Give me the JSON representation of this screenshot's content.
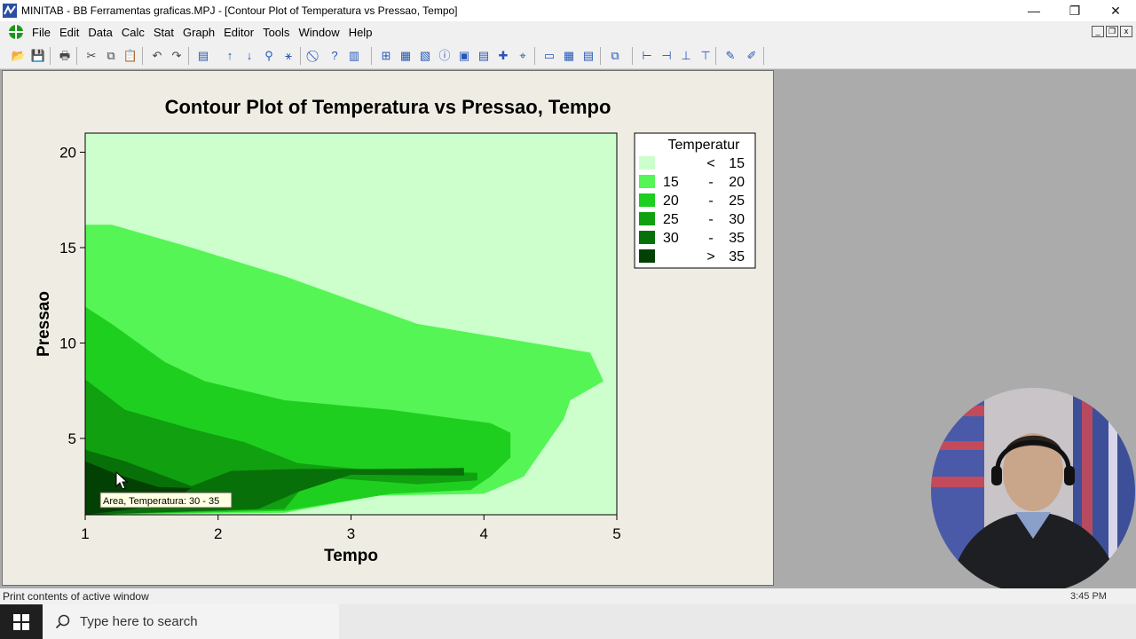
{
  "window": {
    "title": "MINITAB - BB Ferramentas graficas.MPJ - [Contour Plot of Temperatura vs Pressao, Tempo]",
    "minimize_glyph": "—",
    "restore_glyph": "❐",
    "close_glyph": "✕"
  },
  "menu": {
    "items": [
      "File",
      "Edit",
      "Data",
      "Calc",
      "Stat",
      "Graph",
      "Editor",
      "Tools",
      "Window",
      "Help"
    ],
    "mdi_minimize": "_",
    "mdi_restore": "❐",
    "mdi_close": "x"
  },
  "toolbar": {
    "icons": [
      "open-icon",
      "save-icon",
      "print-icon",
      "cut-icon",
      "copy-icon",
      "paste-icon",
      "undo-icon",
      "redo-icon",
      "session-window-icon",
      "up-arrow-icon",
      "down-arrow-icon",
      "binoculars-icon",
      "find-replace-icon",
      "cancel-icon",
      "help-icon",
      "manage-icon",
      "new-graph-icon",
      "worksheet-icon",
      "layout-icon",
      "info-icon",
      "history-icon",
      "report-pad-icon",
      "brush-icon",
      "select-icon",
      "edit-attributes-icon",
      "data-window-icon",
      "table-icon",
      "tile-icon",
      "add-icon",
      "remove-icon",
      "options-icon",
      "tools-icon",
      "pen-icon",
      "eraser-icon"
    ]
  },
  "chart_data": {
    "type": "contour",
    "title": "Contour Plot of Temperatura vs Pressao, Tempo",
    "xlabel": "Tempo",
    "ylabel": "Pressao",
    "xlim": [
      1,
      5
    ],
    "ylim": [
      1,
      21
    ],
    "xticks": [
      "1",
      "2",
      "3",
      "4",
      "5"
    ],
    "yticks": [
      "5",
      "10",
      "15",
      "20"
    ],
    "ytick_values": [
      5,
      10,
      15,
      20
    ],
    "legend": {
      "title": "Temperatur",
      "position": "right",
      "entries": [
        {
          "lo": "",
          "sep": "<",
          "hi": "15",
          "color": "#ccffcc"
        },
        {
          "lo": "15",
          "sep": "-",
          "hi": "20",
          "color": "#55f555"
        },
        {
          "lo": "20",
          "sep": "-",
          "hi": "25",
          "color": "#1fcf1f"
        },
        {
          "lo": "25",
          "sep": "-",
          "hi": "30",
          "color": "#10a010"
        },
        {
          "lo": "30",
          "sep": "-",
          "hi": "35",
          "color": "#087008"
        },
        {
          "lo": "",
          "sep": ">",
          "hi": "35",
          "color": "#034003"
        }
      ]
    },
    "regions": [
      {
        "level": "15 - 20",
        "color": "#55f555",
        "points": [
          [
            1,
            1
          ],
          [
            2.5,
            1.1
          ],
          [
            3.2,
            2
          ],
          [
            4.0,
            2.1
          ],
          [
            4.3,
            3.0
          ],
          [
            4.5,
            5.0
          ],
          [
            4.6,
            6.0
          ],
          [
            4.65,
            7.0
          ],
          [
            4.9,
            8.0
          ],
          [
            4.8,
            9.5
          ],
          [
            3.5,
            11.0
          ],
          [
            2.5,
            13.5
          ],
          [
            1.8,
            15.0
          ],
          [
            1.2,
            16.2
          ],
          [
            1,
            16.2
          ]
        ]
      },
      {
        "level": "20 - 25",
        "color": "#1fcf1f",
        "points": [
          [
            1,
            1
          ],
          [
            2.5,
            1.2
          ],
          [
            3.3,
            2.1
          ],
          [
            3.9,
            2.3
          ],
          [
            4.05,
            3.0
          ],
          [
            4.2,
            4.0
          ],
          [
            4.2,
            5.3
          ],
          [
            4.05,
            5.8
          ],
          [
            3.3,
            6.5
          ],
          [
            2.5,
            7.0
          ],
          [
            1.9,
            8.0
          ],
          [
            1.6,
            9.0
          ],
          [
            1.2,
            11.0
          ],
          [
            1,
            11.9
          ]
        ]
      },
      {
        "level": "25 - 30",
        "color": "#10a010",
        "points": [
          [
            1,
            1
          ],
          [
            2.5,
            1.3
          ],
          [
            2.7,
            3.0
          ],
          [
            3.5,
            2.6
          ],
          [
            3.95,
            2.8
          ],
          [
            3.95,
            3.2
          ],
          [
            3.2,
            3.3
          ],
          [
            2.6,
            3.7
          ],
          [
            2.2,
            4.8
          ],
          [
            1.8,
            5.5
          ],
          [
            1.3,
            6.5
          ],
          [
            1,
            8.1
          ]
        ]
      },
      {
        "level": "30 - 35",
        "color": "#087008",
        "points": [
          [
            1,
            1
          ],
          [
            2.3,
            1.3
          ],
          [
            2.6,
            2.2
          ],
          [
            3.0,
            3.1
          ],
          [
            3.85,
            3.05
          ],
          [
            3.85,
            3.45
          ],
          [
            3.2,
            3.4
          ],
          [
            2.6,
            3.4
          ],
          [
            2.1,
            3.3
          ],
          [
            1.8,
            2.5
          ],
          [
            1.3,
            3.8
          ],
          [
            1,
            4.4
          ]
        ]
      },
      {
        "level": "> 35",
        "color": "#034003",
        "points": [
          [
            1,
            1
          ],
          [
            1.6,
            1.5
          ],
          [
            1.8,
            2.4
          ],
          [
            1.55,
            2.45
          ],
          [
            1.25,
            3.1
          ],
          [
            1,
            3.8
          ]
        ]
      }
    ],
    "tooltip": "Area, Temperatura: 30  -  35"
  },
  "status": {
    "text": "Print contents of active window",
    "clock": "3:45 PM"
  },
  "taskbar": {
    "search_placeholder": "Type here to search"
  }
}
